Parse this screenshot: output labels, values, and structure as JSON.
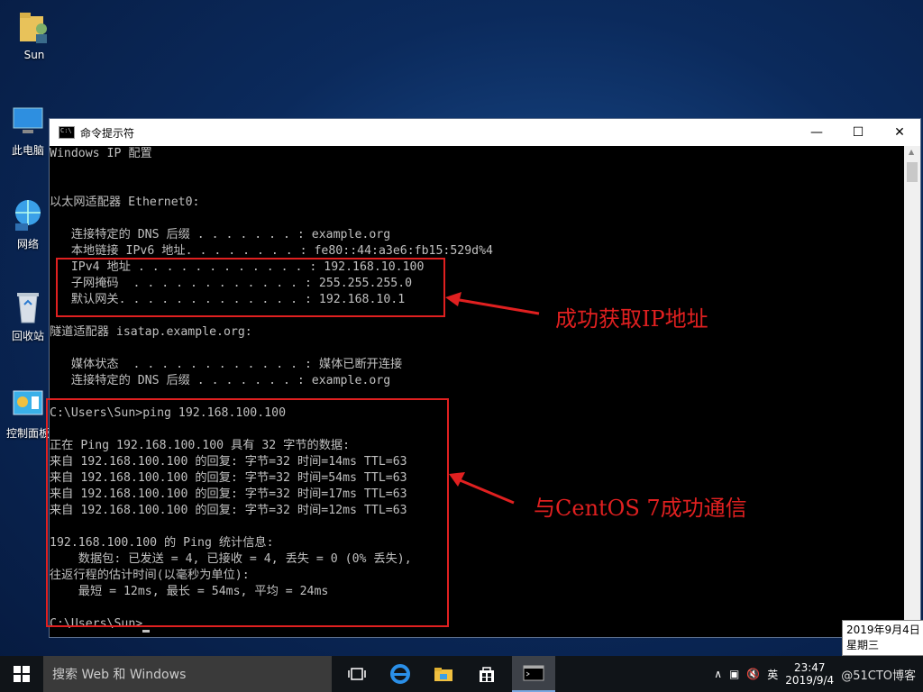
{
  "desktop": {
    "icons": [
      {
        "label": "Sun"
      },
      {
        "label": "此电脑"
      },
      {
        "label": "网络"
      },
      {
        "label": "回收站"
      },
      {
        "label": "控制面板"
      }
    ]
  },
  "window": {
    "title": "命令提示符",
    "minimize": "—",
    "maximize": "☐",
    "close": "✕"
  },
  "console": {
    "lines": [
      "Windows IP 配置",
      "",
      "",
      "以太网适配器 Ethernet0:",
      "",
      "   连接特定的 DNS 后缀 . . . . . . . : example.org",
      "   本地链接 IPv6 地址. . . . . . . . : fe80::44:a3e6:fb15:529d%4",
      "   IPv4 地址 . . . . . . . . . . . . : 192.168.10.100",
      "   子网掩码  . . . . . . . . . . . . : 255.255.255.0",
      "   默认网关. . . . . . . . . . . . . : 192.168.10.1",
      "",
      "隧道适配器 isatap.example.org:",
      "",
      "   媒体状态  . . . . . . . . . . . . : 媒体已断开连接",
      "   连接特定的 DNS 后缀 . . . . . . . : example.org",
      "",
      "C:\\Users\\Sun>ping 192.168.100.100",
      "",
      "正在 Ping 192.168.100.100 具有 32 字节的数据:",
      "来自 192.168.100.100 的回复: 字节=32 时间=14ms TTL=63",
      "来自 192.168.100.100 的回复: 字节=32 时间=54ms TTL=63",
      "来自 192.168.100.100 的回复: 字节=32 时间=17ms TTL=63",
      "来自 192.168.100.100 的回复: 字节=32 时间=12ms TTL=63",
      "",
      "192.168.100.100 的 Ping 统计信息:",
      "    数据包: 已发送 = 4, 已接收 = 4, 丢失 = 0 (0% 丢失),",
      "往返行程的估计时间(以毫秒为单位):",
      "    最短 = 12ms, 最长 = 54ms, 平均 = 24ms",
      "",
      "C:\\Users\\Sun>"
    ]
  },
  "annotations": {
    "ip_success": "成功获取IP地址",
    "ping_success": "与CentOS 7成功通信"
  },
  "taskbar": {
    "search_placeholder": "搜索 Web 和 Windows",
    "tray_ime": "英",
    "clock_time": "23:47",
    "clock_date": "2019/9/4",
    "watermark": "@51CTO博客"
  },
  "tooltip": {
    "date": "2019年9月4日",
    "weekday": "星期三"
  },
  "colors": {
    "annotation_red": "#e02020",
    "console_text": "#c0c0c0"
  }
}
